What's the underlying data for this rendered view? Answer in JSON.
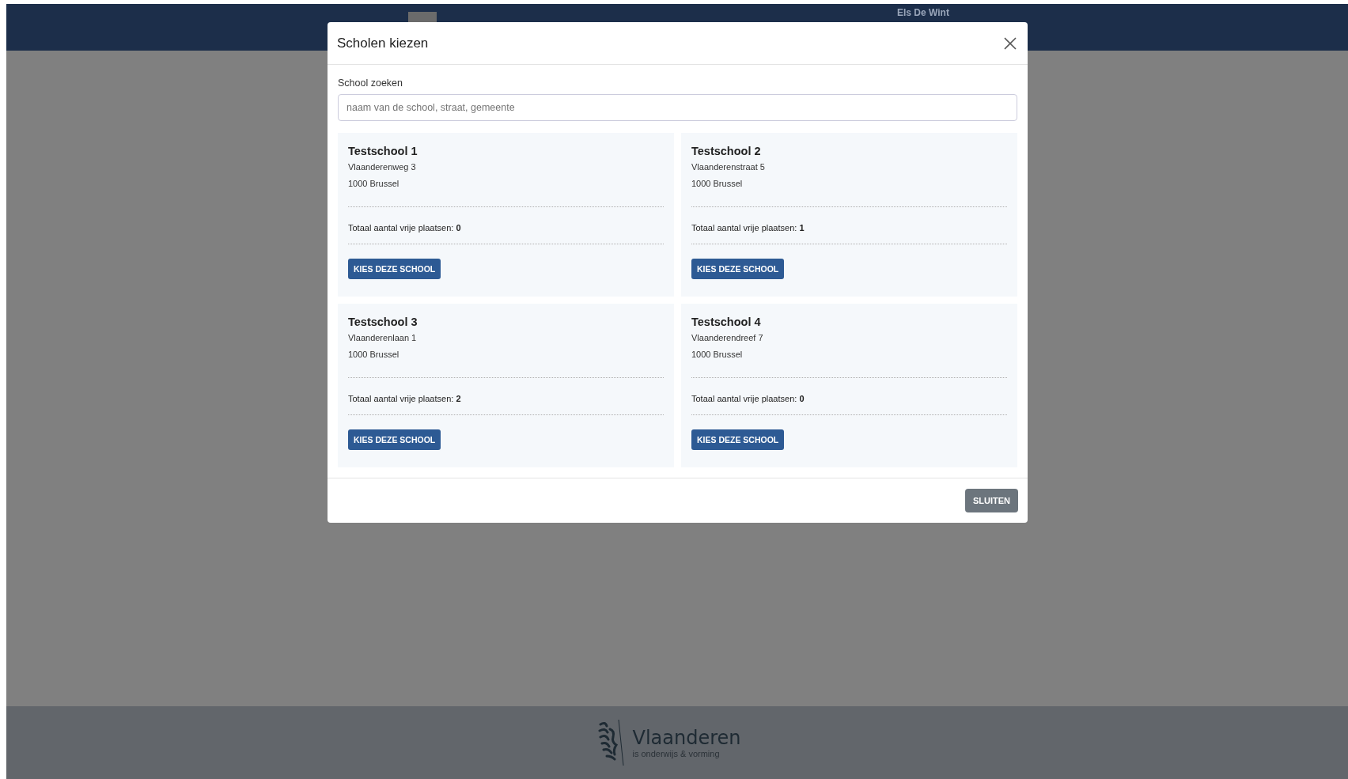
{
  "header": {
    "user_name": "Els De Wint"
  },
  "modal": {
    "title": "Scholen kiezen",
    "search": {
      "label": "School zoeken",
      "placeholder": "naam van de school, straat, gemeente"
    },
    "schools": [
      {
        "name": "Testschool 1",
        "street": "Vlaanderenweg 3",
        "city": "1000 Brussel",
        "places_label": "Totaal aantal vrije plaatsen:",
        "places": "0",
        "button": "KIES DEZE SCHOOL"
      },
      {
        "name": "Testschool 2",
        "street": "Vlaanderenstraat 5",
        "city": "1000 Brussel",
        "places_label": "Totaal aantal vrije plaatsen:",
        "places": "1",
        "button": "KIES DEZE SCHOOL"
      },
      {
        "name": "Testschool 3",
        "street": "Vlaanderenlaan 1",
        "city": "1000 Brussel",
        "places_label": "Totaal aantal vrije plaatsen:",
        "places": "2",
        "button": "KIES DEZE SCHOOL"
      },
      {
        "name": "Testschool 4",
        "street": "Vlaanderendreef 7",
        "city": "1000 Brussel",
        "places_label": "Totaal aantal vrije plaatsen:",
        "places": "0",
        "button": "KIES DEZE SCHOOL"
      }
    ],
    "close_button": "SLUITEN"
  },
  "footer": {
    "brand": "Vlaanderen",
    "tagline": "is onderwijs & vorming"
  }
}
